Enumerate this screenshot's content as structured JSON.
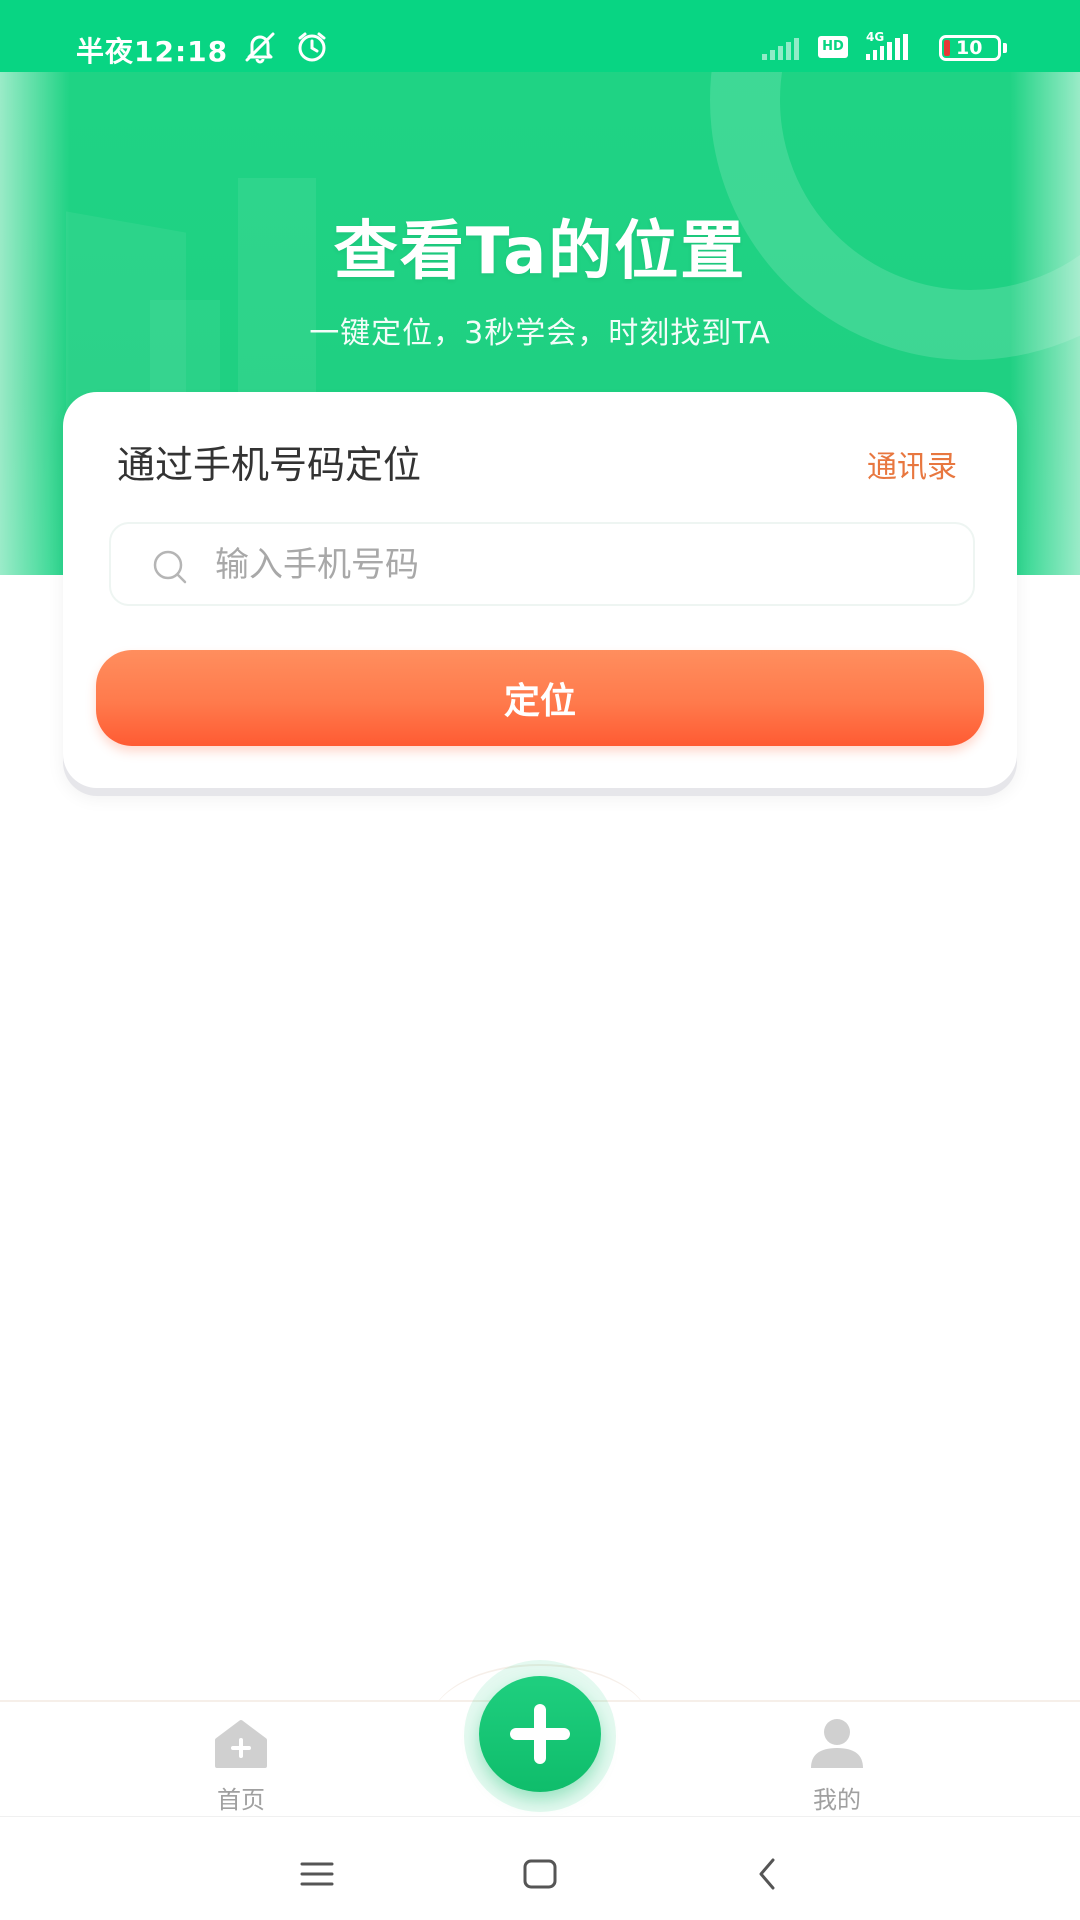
{
  "status_bar": {
    "time": "半夜12:18",
    "hd_label": "HD",
    "network_label": "4G",
    "battery_level": "10",
    "icons": [
      "mute-icon",
      "alarm-icon",
      "signal-icon",
      "hd-icon",
      "4g-signal-icon",
      "battery-icon"
    ]
  },
  "hero": {
    "title": "查看Ta的位置",
    "subtitle": "一键定位，3秒学会，时刻找到TA"
  },
  "card": {
    "title": "通过手机号码定位",
    "contacts_label": "通讯录",
    "search_placeholder": "输入手机号码",
    "search_value": "",
    "locate_label": "定位"
  },
  "bottom_nav": {
    "items": [
      {
        "label": "首页",
        "icon": "home-icon"
      },
      {
        "label": "我的",
        "icon": "person-icon"
      }
    ],
    "fab_icon": "plus-icon"
  },
  "system_nav": {
    "icons": [
      "menu-icon",
      "home-square-icon",
      "back-icon"
    ]
  },
  "colors": {
    "brand_green": "#08d583",
    "accent_orange": "#ff6a3d",
    "link_orange": "#e8773f"
  }
}
